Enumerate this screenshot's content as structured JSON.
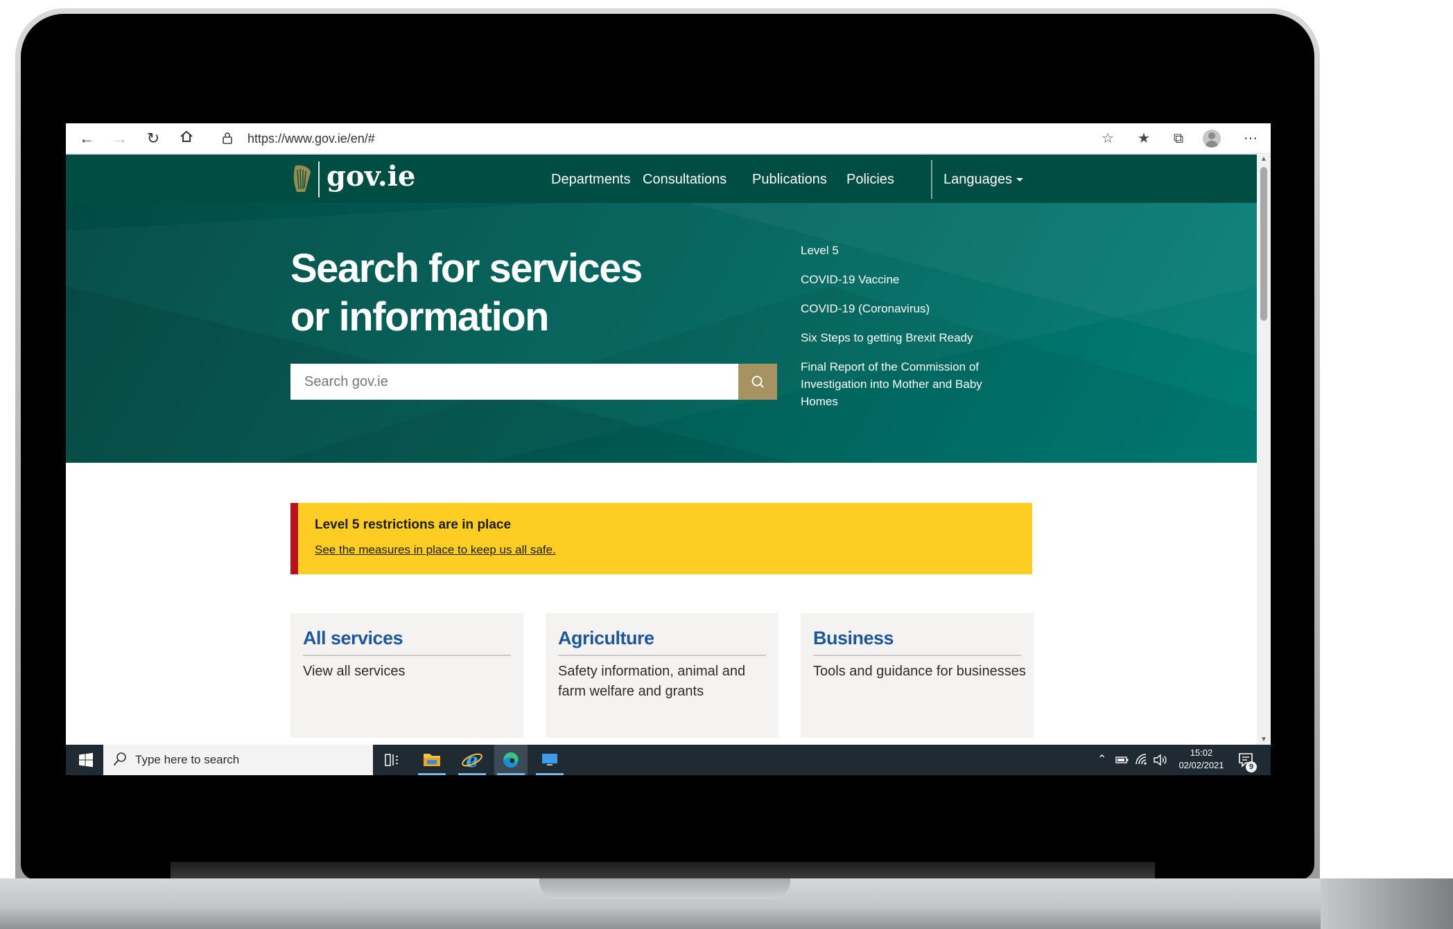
{
  "browser": {
    "url": "https://www.gov.ie/en/#"
  },
  "site": {
    "logo_text": "gov.ie",
    "nav": [
      "Departments",
      "Consultations",
      "Publications",
      "Policies"
    ],
    "languages_label": "Languages"
  },
  "hero": {
    "title_line1": "Search for services",
    "title_line2": "or information",
    "search_placeholder": "Search gov.ie",
    "quick_links": [
      "Level 5",
      "COVID-19 Vaccine",
      "COVID-19 (Coronavirus)",
      "Six Steps to getting Brexit Ready",
      "Final Report of the Commission of Investigation into Mother and Baby Homes"
    ]
  },
  "alert": {
    "title": "Level 5 restrictions are in place",
    "link": "See the measures in place to keep us all safe."
  },
  "cards": [
    {
      "title": "All services",
      "description": "View all services"
    },
    {
      "title": "Agriculture",
      "description": "Safety information, animal and farm welfare and grants"
    },
    {
      "title": "Business",
      "description": "Tools and guidance for businesses"
    }
  ],
  "taskbar": {
    "search_placeholder": "Type here to search",
    "time": "15:02",
    "date": "02/02/2021",
    "notification_count": "9"
  },
  "colors": {
    "header_green": "#004d44",
    "hero_teal": "#006e66",
    "search_button_gold": "#a79262",
    "alert_yellow": "#fdcd24",
    "alert_red": "#b7121f",
    "card_title_blue": "#1d5798",
    "taskbar": "#1f2a33"
  }
}
